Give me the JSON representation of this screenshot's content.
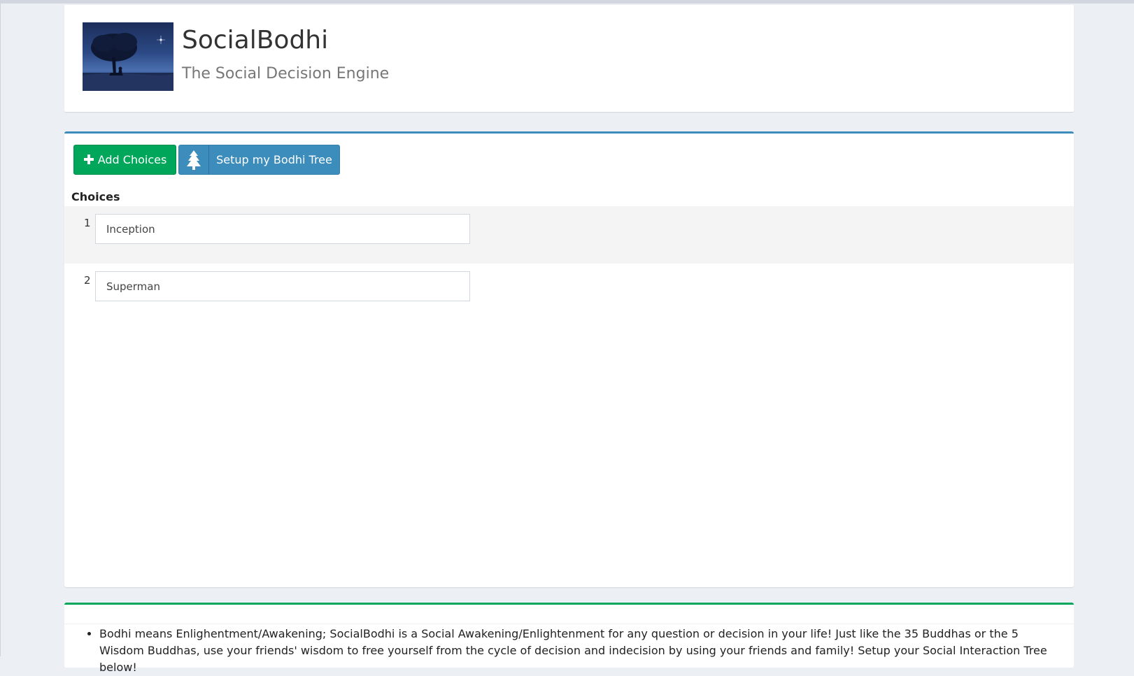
{
  "header": {
    "title": "SocialBodhi",
    "subtitle": "The Social Decision Engine",
    "logo_icon": "bodhi-tree-logo"
  },
  "toolbar": {
    "add_choices_label": "Add Choices",
    "add_choices_icon": "plus-icon",
    "setup_tree_label": "Setup my Bodhi Tree",
    "setup_tree_icon": "tree-icon"
  },
  "choices": {
    "heading": "Choices",
    "items": [
      {
        "number": "1",
        "value": "Inception"
      },
      {
        "number": "2",
        "value": "Superman"
      }
    ]
  },
  "info": {
    "items": [
      "Bodhi means Enlighentment/Awakening; SocialBodhi is a Social Awakening/Enlightenment for any question or decision in your life! Just like the 35 Buddhas or the 5 Wisdom Buddhas, use your friends' wisdom to free yourself from the cycle of decision and indecision by using your friends and family! Setup your Social Interaction Tree below!"
    ]
  },
  "colors": {
    "primary": "#3c8dbc",
    "success": "#00a65a",
    "background": "#ecf0f5"
  }
}
